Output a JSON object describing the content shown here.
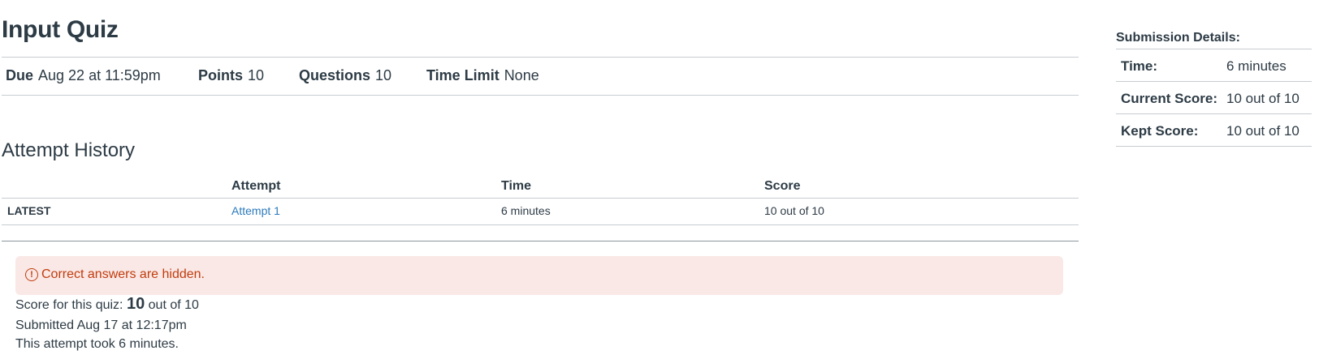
{
  "quiz": {
    "title": "Input Quiz",
    "meta": [
      {
        "label": "Due",
        "value": "Aug 22 at 11:59pm"
      },
      {
        "label": "Points",
        "value": "10"
      },
      {
        "label": "Questions",
        "value": "10"
      },
      {
        "label": "Time Limit",
        "value": "None"
      }
    ]
  },
  "attempt_history": {
    "title": "Attempt History",
    "columns": [
      "",
      "Attempt",
      "Time",
      "Score"
    ],
    "rows": [
      {
        "tag": "LATEST",
        "attempt": "Attempt 1",
        "time": "6 minutes",
        "score": "10 out of 10"
      }
    ]
  },
  "alert": {
    "icon": "warning-circle-icon",
    "text": "Correct answers are hidden."
  },
  "summary": {
    "score_prefix": "Score for this quiz: ",
    "score_value": "10",
    "score_suffix": " out of 10",
    "submitted": "Submitted Aug 17 at 12:17pm",
    "duration": "This attempt took 6 minutes."
  },
  "submission_details": {
    "title": "Submission Details:",
    "rows": [
      {
        "label": "Time:",
        "value": "6 minutes"
      },
      {
        "label": "Current Score:",
        "value": "10 out of 10"
      },
      {
        "label": "Kept Score:",
        "value": "10 out of 10"
      }
    ]
  },
  "colors": {
    "link": "#2b7abc",
    "alert_bg": "#f9e8e6",
    "alert_text": "#c23c0d",
    "text": "#2d3b45"
  }
}
